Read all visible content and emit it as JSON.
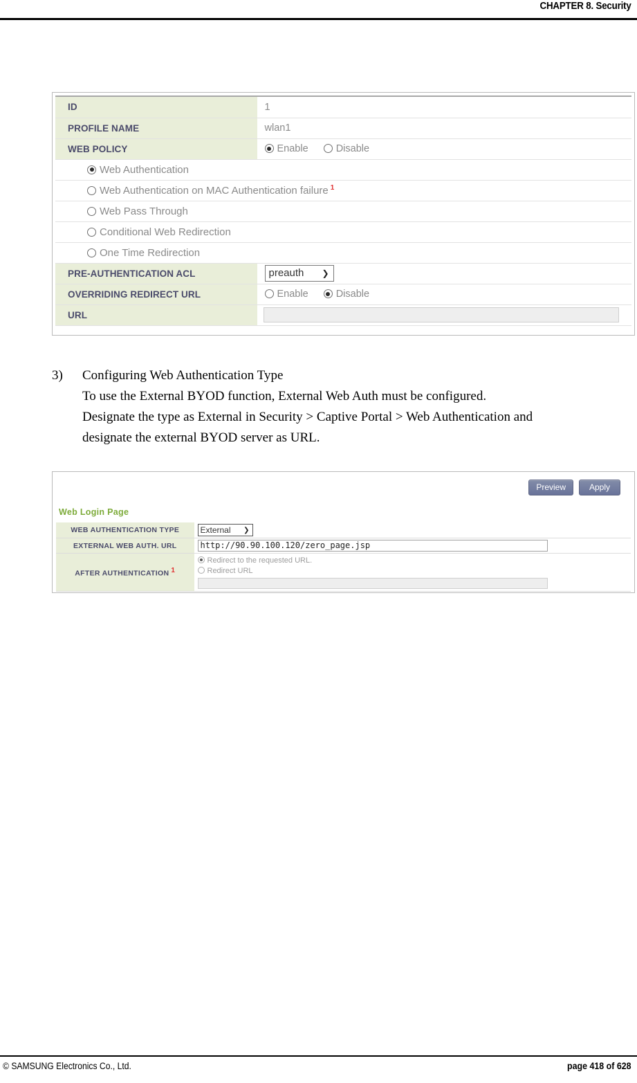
{
  "header": {
    "chapter_title": "CHAPTER 8. Security"
  },
  "footer": {
    "copyright": "© SAMSUNG Electronics Co., Ltd.",
    "page_number": "page 418 of 628"
  },
  "colors": {
    "label_cell_bg": "#e9eed9",
    "label_text": "#4a4a6a",
    "section_title_green": "#7dab3a",
    "footnote_red": "#e03030",
    "button_blue": "#69739a"
  },
  "figure_web_policy": {
    "rows": [
      {
        "label": "ID",
        "value": "1"
      },
      {
        "label": "PROFILE NAME",
        "value": "wlan1"
      }
    ],
    "web_policy": {
      "label": "WEB POLICY",
      "enable_label": "Enable",
      "disable_label": "Disable",
      "selected": "Enable"
    },
    "policy_options": [
      {
        "label": "Web Authentication",
        "selected": true,
        "footnote": ""
      },
      {
        "label": "Web Authentication on MAC Authentication failure",
        "selected": false,
        "footnote": "1"
      },
      {
        "label": "Web Pass Through",
        "selected": false,
        "footnote": ""
      },
      {
        "label": "Conditional Web Redirection",
        "selected": false,
        "footnote": ""
      },
      {
        "label": "One Time Redirection",
        "selected": false,
        "footnote": ""
      }
    ],
    "preauth_acl": {
      "label": "PRE-AUTHENTICATION ACL",
      "selected_option": "preauth"
    },
    "overriding_redirect_url": {
      "label": "OVERRIDING REDIRECT URL",
      "enable_label": "Enable",
      "disable_label": "Disable",
      "selected": "Disable"
    },
    "url": {
      "label": "URL",
      "value": ""
    }
  },
  "instruction": {
    "marker": "3)",
    "line1": "Configuring Web Authentication Type",
    "line2": "To use the External BYOD function, External Web Auth must be configured.",
    "line3": "Designate the type as External in Security > Captive Portal > Web Authentication and",
    "line4": "designate the external BYOD server as URL."
  },
  "figure_web_login_page": {
    "buttons": {
      "preview": "Preview",
      "apply": "Apply"
    },
    "section_title": "Web Login Page",
    "web_authentication_type": {
      "label": "WEB AUTHENTICATION TYPE",
      "selected_option": "External"
    },
    "external_web_auth_url": {
      "label": "EXTERNAL WEB AUTH. URL",
      "value": "http://90.90.100.120/zero_page.jsp"
    },
    "after_authentication": {
      "label": "AFTER AUTHENTICATION",
      "footnote": "1",
      "option_requested": "Redirect to the requested URL.",
      "option_redirect_url": "Redirect URL",
      "selected": "Redirect to the requested URL.",
      "redirect_url_value": ""
    }
  }
}
